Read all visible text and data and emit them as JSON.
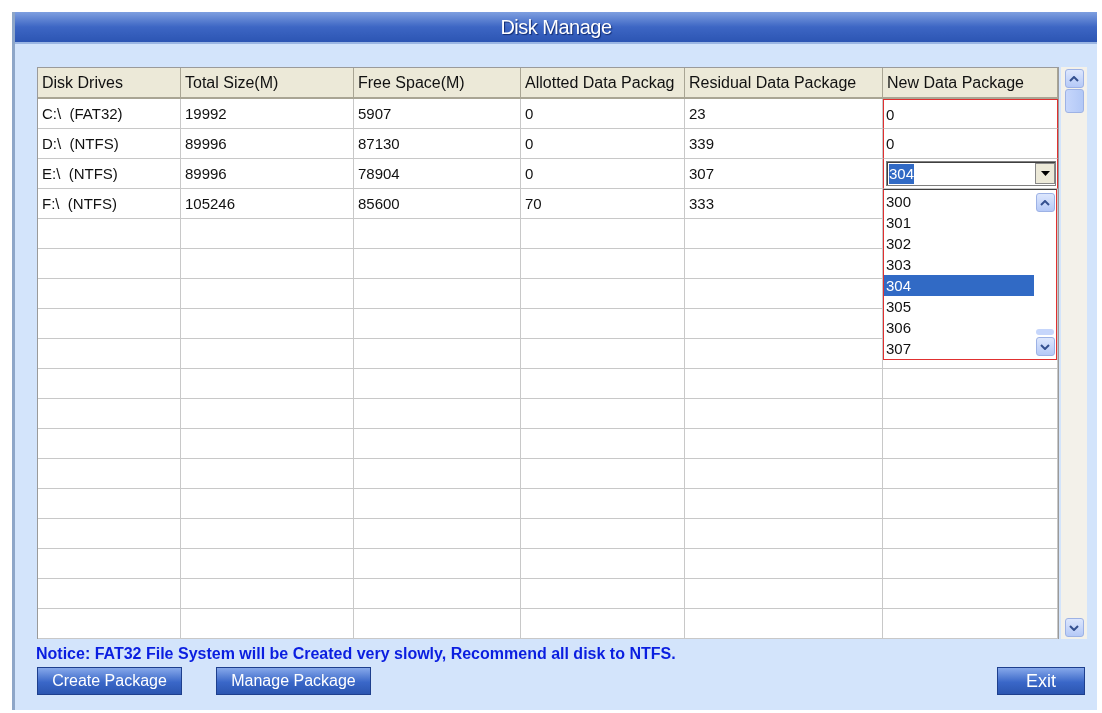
{
  "window": {
    "title": "Disk Manage"
  },
  "table": {
    "columns": [
      "Disk Drives",
      "Total Size(M)",
      "Free Space(M)",
      "Allotted Data Packag",
      "Residual Data Package",
      "New Data Package"
    ],
    "rows": [
      {
        "cells": [
          "C:\\  (FAT32)",
          "19992",
          "5907",
          "0",
          "23"
        ],
        "new_package": {
          "kind": "text",
          "value": "0"
        }
      },
      {
        "cells": [
          "D:\\  (NTFS)",
          "89996",
          "87130",
          "0",
          "339"
        ],
        "new_package": {
          "kind": "text",
          "value": "0"
        }
      },
      {
        "cells": [
          "E:\\  (NTFS)",
          "89996",
          "78904",
          "0",
          "307"
        ],
        "new_package": {
          "kind": "dropdown",
          "value": "304"
        }
      },
      {
        "cells": [
          "F:\\  (NTFS)",
          "105246",
          "85600",
          "70",
          "333"
        ]
      }
    ]
  },
  "dropdown_list": {
    "items": [
      {
        "label": "300",
        "selected": false
      },
      {
        "label": "301",
        "selected": false
      },
      {
        "label": "302",
        "selected": false
      },
      {
        "label": "303",
        "selected": false
      },
      {
        "label": "304",
        "selected": true
      },
      {
        "label": "305",
        "selected": false
      },
      {
        "label": "306",
        "selected": false
      },
      {
        "label": "307",
        "selected": false
      }
    ]
  },
  "notice": "Notice:  FAT32 File System will be Created very slowly, Recommend all disk to NTFS.",
  "buttons": [
    "Create Package",
    "Manage Package"
  ],
  "exit_button": "Exit"
}
